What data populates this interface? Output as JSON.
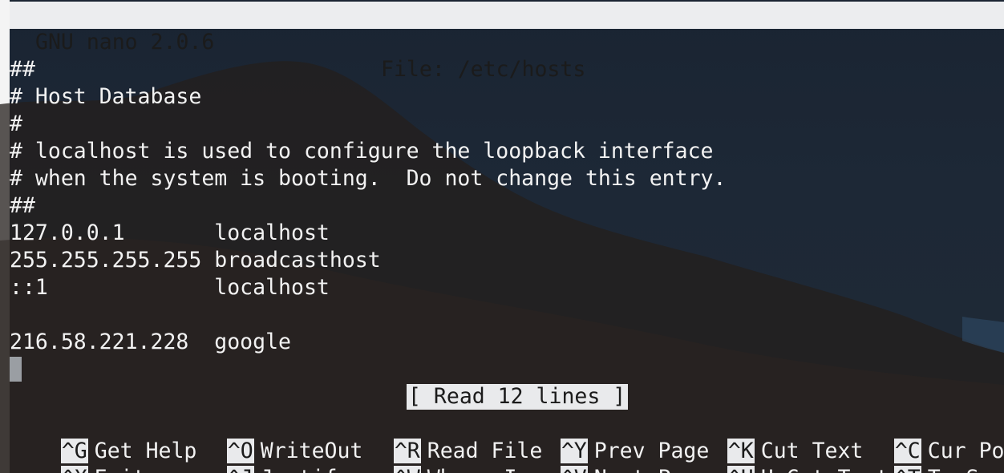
{
  "titlebar": {
    "app": "GNU nano 2.0.6",
    "file": "File: /etc/hosts"
  },
  "editor": {
    "lines": [
      "##",
      "# Host Database",
      "#",
      "# localhost is used to configure the loopback interface",
      "# when the system is booting.  Do not change this entry.",
      "##",
      "127.0.0.1       localhost",
      "255.255.255.255 broadcasthost",
      "::1             localhost",
      "",
      "216.58.221.228  google"
    ]
  },
  "status": "[ Read 12 lines ]",
  "shortcuts": {
    "row1": [
      {
        "key": "^G",
        "label": "Get Help"
      },
      {
        "key": "^O",
        "label": "WriteOut"
      },
      {
        "key": "^R",
        "label": "Read File"
      },
      {
        "key": "^Y",
        "label": "Prev Page"
      },
      {
        "key": "^K",
        "label": "Cut Text"
      },
      {
        "key": "^C",
        "label": "Cur Pos"
      }
    ],
    "row2": [
      {
        "key": "^X",
        "label": "Exit"
      },
      {
        "key": "^J",
        "label": "Justify"
      },
      {
        "key": "^W",
        "label": "Where Is"
      },
      {
        "key": "^V",
        "label": "Next Page"
      },
      {
        "key": "^U",
        "label": "UnCut Text"
      },
      {
        "key": "^T",
        "label": "To Spell"
      }
    ]
  },
  "colors": {
    "background": "#1d2836",
    "text": "#f2f2f2",
    "bar": "#ecedef",
    "bar_text": "#1b1b1b",
    "cursor": "#9a9ea3"
  }
}
